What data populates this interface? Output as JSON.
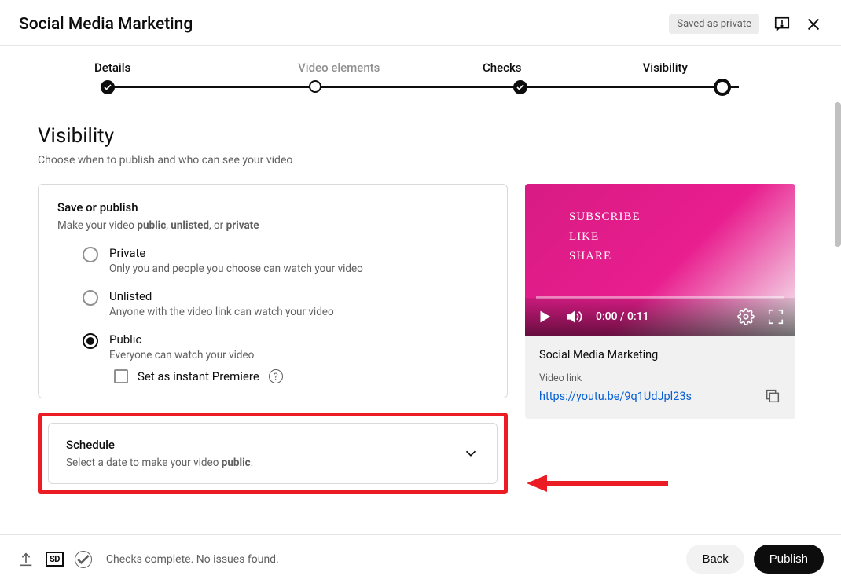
{
  "header": {
    "title": "Social Media Marketing",
    "saved_badge": "Saved as private"
  },
  "stepper": {
    "steps": [
      {
        "label": "Details",
        "state": "done"
      },
      {
        "label": "Video elements",
        "state": "inactive"
      },
      {
        "label": "Checks",
        "state": "done"
      },
      {
        "label": "Visibility",
        "state": "current"
      }
    ]
  },
  "page": {
    "title": "Visibility",
    "subtitle": "Choose when to publish and who can see your video"
  },
  "save_card": {
    "title": "Save or publish",
    "sub_prefix": "Make your video ",
    "bold1": "public",
    "sep1": ", ",
    "bold2": "unlisted",
    "sep2": ", or ",
    "bold3": "private",
    "options": [
      {
        "title": "Private",
        "desc": "Only you and people you choose can watch your video",
        "selected": false
      },
      {
        "title": "Unlisted",
        "desc": "Anyone with the video link can watch your video",
        "selected": false
      },
      {
        "title": "Public",
        "desc": "Everyone can watch your video",
        "selected": true
      }
    ],
    "premiere_label": "Set as instant Premiere"
  },
  "schedule_card": {
    "title": "Schedule",
    "sub_prefix": "Select a date to make your video ",
    "sub_bold": "public",
    "sub_suffix": "."
  },
  "preview": {
    "thumb_words": [
      "SUBSCRIBE",
      "LIKE",
      "SHARE"
    ],
    "time": "0:00 / 0:11",
    "title": "Social Media Marketing",
    "link_label": "Video link",
    "link": "https://youtu.be/9q1UdJpl23s"
  },
  "footer": {
    "status": "Checks complete. No issues found.",
    "back": "Back",
    "publish": "Publish"
  }
}
